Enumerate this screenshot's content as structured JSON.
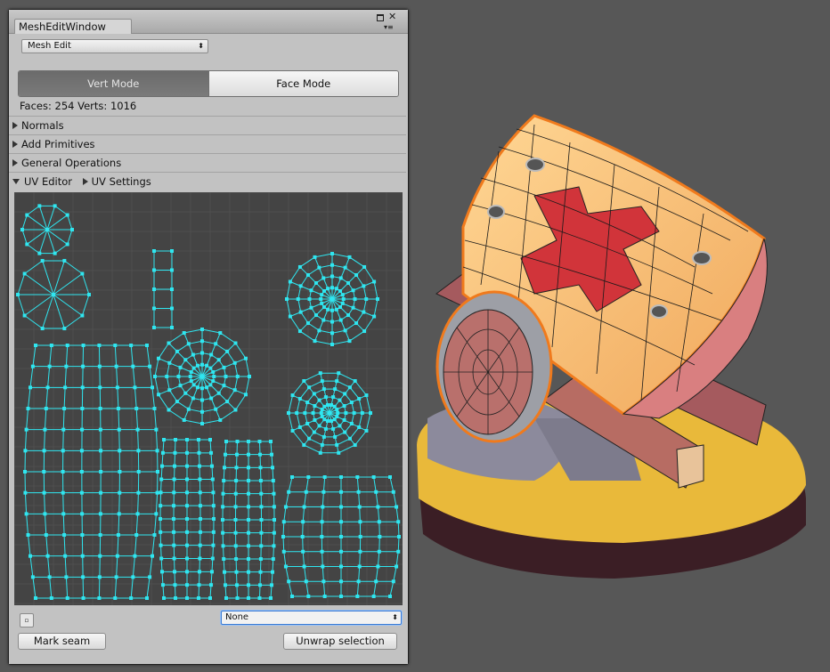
{
  "window": {
    "tab_title": "MeshEditWindow",
    "mode_dropdown": "Mesh Edit",
    "vert_mode_label": "Vert Mode",
    "face_mode_label": "Face Mode",
    "active_mode": "Vert Mode",
    "stats": "Faces: 254 Verts: 1016"
  },
  "foldouts": {
    "normals": "Normals",
    "add_primitives": "Add Primitives",
    "general_operations": "General Operations",
    "uv_editor": "UV Editor",
    "uv_settings": "UV Settings"
  },
  "bottom": {
    "channel_value": "None",
    "mark_seam_label": "Mark seam",
    "unwrap_label": "Unwrap selection"
  },
  "icons": [
    "close-icon",
    "maximize-icon",
    "menu-icon",
    "dropdown-arrow-icon",
    "foldout-arrow-icon"
  ],
  "colors": {
    "uv_wire": "#2fe6f0",
    "selection_outline": "#f07a1c",
    "viewport_bg": "#575757",
    "window_bg": "#c2c2c2"
  }
}
